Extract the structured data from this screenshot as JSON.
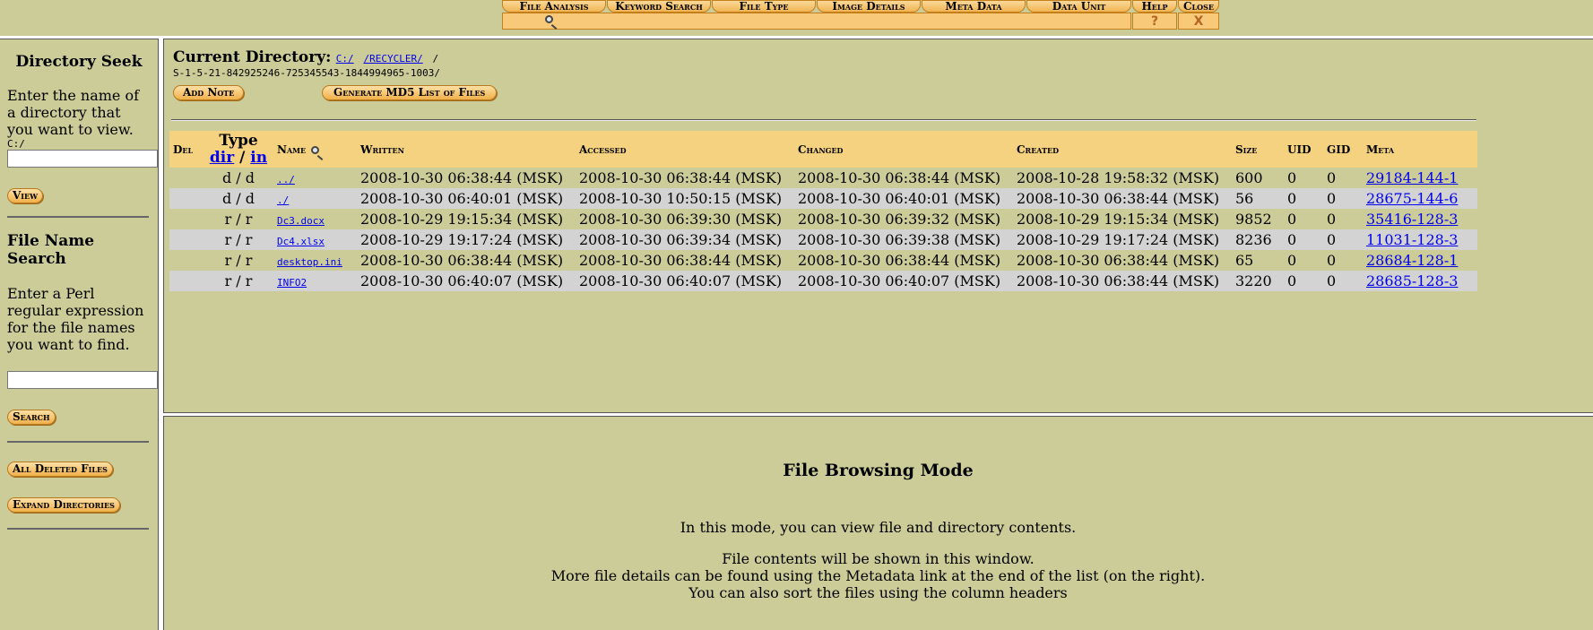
{
  "toolbar": {
    "tabs": [
      "File Analysis",
      "Keyword Search",
      "File Type",
      "Image Details",
      "Meta Data",
      "Data Unit",
      "Help",
      "Close"
    ],
    "help_glyph": "?",
    "close_glyph": "X"
  },
  "left": {
    "dir_seek_title": "Directory Seek",
    "dir_seek_desc": "Enter the name of a directory that you want to view.",
    "dir_seek_default": "C:/",
    "dir_input_value": "",
    "view_label": "View",
    "file_search_title": "File Name Search",
    "file_search_desc": "Enter a Perl regular expression for the file names you want to find.",
    "search_input_value": "",
    "search_label": "Search",
    "all_deleted_label": "All Deleted Files",
    "expand_dirs_label": "Expand Directories"
  },
  "current": {
    "label": "Current Directory:",
    "link_root": "C:/",
    "link_recycler": "/RECYCLER/",
    "sep": "/",
    "subpath": "S-1-5-21-842925246-725345543-1844994965-1003/",
    "add_note_label": "Add Note",
    "md5_label": "Generate MD5 List of Files"
  },
  "table": {
    "headers": {
      "del": "Del",
      "type": "Type",
      "type_dir": "dir",
      "type_sep": "/",
      "type_in": "in",
      "name": "Name",
      "written": "Written",
      "accessed": "Accessed",
      "changed": "Changed",
      "created": "Created",
      "size": "Size",
      "uid": "UID",
      "gid": "GID",
      "meta": "Meta"
    },
    "rows": [
      {
        "type": "d / d",
        "name": "../",
        "written": "2008-10-30 06:38:44 (MSK)",
        "accessed": "2008-10-30 06:38:44 (MSK)",
        "changed": "2008-10-30 06:38:44 (MSK)",
        "created": "2008-10-28 19:58:32 (MSK)",
        "size": "600",
        "uid": "0",
        "gid": "0",
        "meta": "29184-144-1"
      },
      {
        "type": "d / d",
        "name": "./",
        "written": "2008-10-30 06:40:01 (MSK)",
        "accessed": "2008-10-30 10:50:15 (MSK)",
        "changed": "2008-10-30 06:40:01 (MSK)",
        "created": "2008-10-30 06:38:44 (MSK)",
        "size": "56",
        "uid": "0",
        "gid": "0",
        "meta": "28675-144-6"
      },
      {
        "type": "r / r",
        "name": "Dc3.docx",
        "written": "2008-10-29 19:15:34 (MSK)",
        "accessed": "2008-10-30 06:39:30 (MSK)",
        "changed": "2008-10-30 06:39:32 (MSK)",
        "created": "2008-10-29 19:15:34 (MSK)",
        "size": "9852",
        "uid": "0",
        "gid": "0",
        "meta": "35416-128-3"
      },
      {
        "type": "r / r",
        "name": "Dc4.xlsx",
        "written": "2008-10-29 19:17:24 (MSK)",
        "accessed": "2008-10-30 06:39:34 (MSK)",
        "changed": "2008-10-30 06:39:38 (MSK)",
        "created": "2008-10-29 19:17:24 (MSK)",
        "size": "8236",
        "uid": "0",
        "gid": "0",
        "meta": "11031-128-3"
      },
      {
        "type": "r / r",
        "name": "desktop.ini",
        "written": "2008-10-30 06:38:44 (MSK)",
        "accessed": "2008-10-30 06:38:44 (MSK)",
        "changed": "2008-10-30 06:38:44 (MSK)",
        "created": "2008-10-30 06:38:44 (MSK)",
        "size": "65",
        "uid": "0",
        "gid": "0",
        "meta": "28684-128-1"
      },
      {
        "type": "r / r",
        "name": "INFO2",
        "written": "2008-10-30 06:40:07 (MSK)",
        "accessed": "2008-10-30 06:40:07 (MSK)",
        "changed": "2008-10-30 06:40:07 (MSK)",
        "created": "2008-10-30 06:38:44 (MSK)",
        "size": "3220",
        "uid": "0",
        "gid": "0",
        "meta": "28685-128-3"
      }
    ]
  },
  "info": {
    "title": "File Browsing Mode",
    "p1": "In this mode, you can view file and directory contents.",
    "p2a": "File contents will be shown in this window.",
    "p2b": "More file details can be found using the Metadata link at the end of the list (on the right).",
    "p2c": "You can also sort the files using the column headers"
  },
  "colors": {
    "background": "#cccc99",
    "header_bg": "#f5d27f",
    "button_orange": "#f0b452",
    "link": "#0000ee",
    "alt_row": "#d3d3d3"
  }
}
